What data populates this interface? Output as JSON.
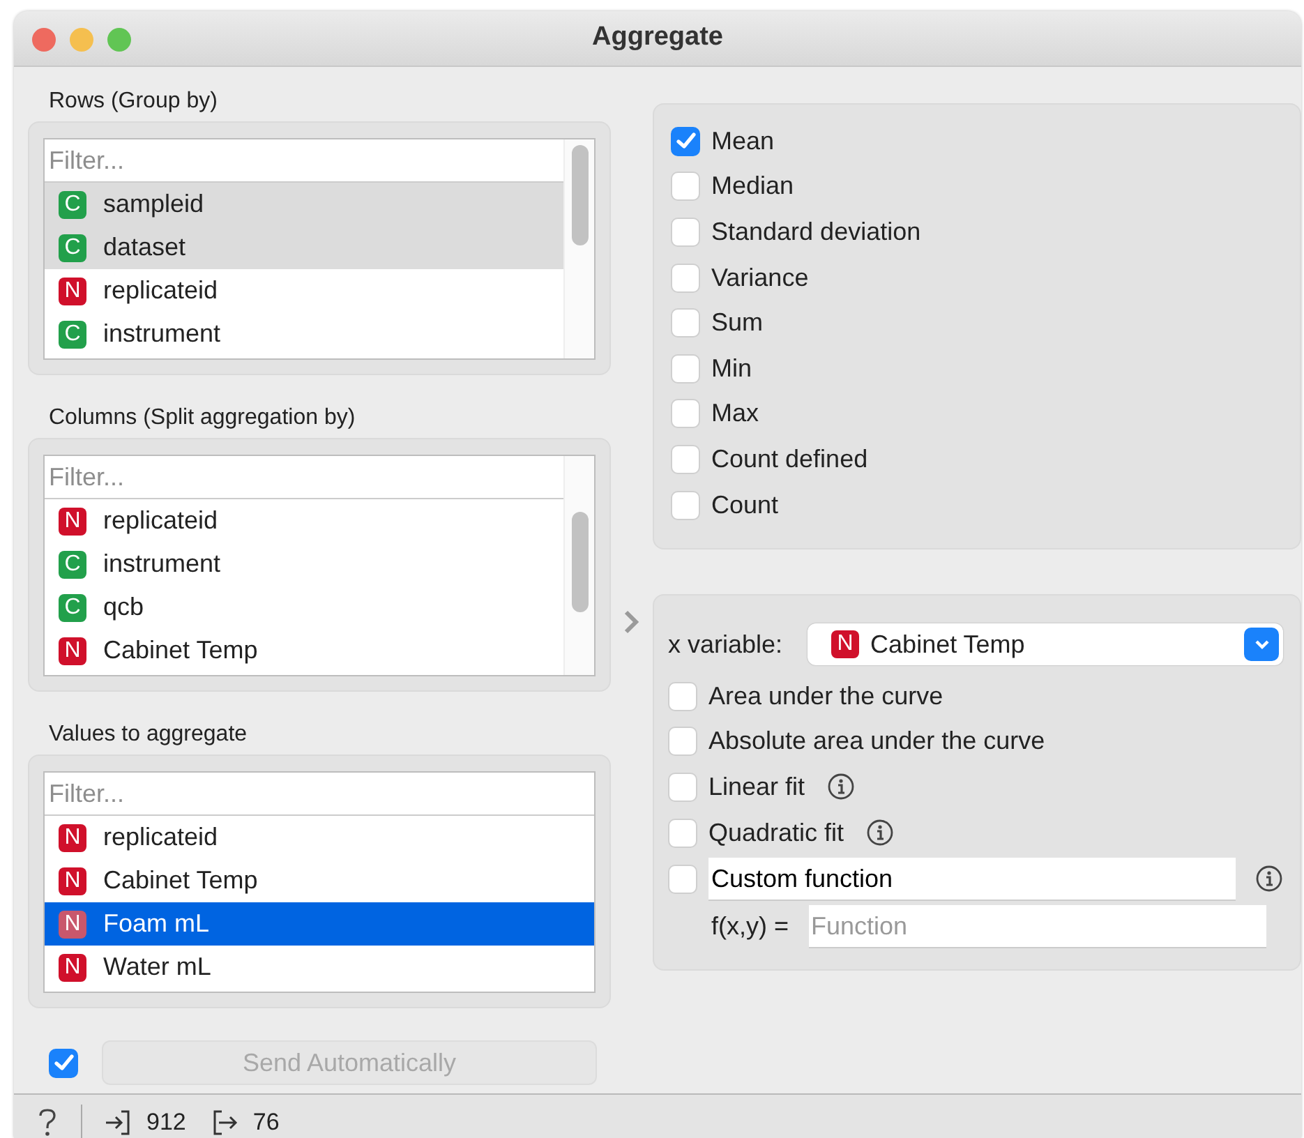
{
  "window": {
    "title": "Aggregate"
  },
  "rows_group_by": {
    "label": "Rows (Group by)",
    "focused": false,
    "filter": {
      "placeholder": "Filter..."
    },
    "scrollbar": true,
    "items": [
      {
        "type": "C",
        "name": "sampleid",
        "selected": true
      },
      {
        "type": "C",
        "name": "dataset",
        "selected": true
      },
      {
        "type": "N",
        "name": "replicateid",
        "selected": false
      },
      {
        "type": "C",
        "name": "instrument",
        "selected": false
      }
    ]
  },
  "columns_split_by": {
    "label": "Columns (Split aggregation by)",
    "filter": {
      "placeholder": "Filter..."
    },
    "scrollbar": true,
    "items": [
      {
        "type": "N",
        "name": "replicateid",
        "selected": false
      },
      {
        "type": "C",
        "name": "instrument",
        "selected": false
      },
      {
        "type": "C",
        "name": "qcb",
        "selected": false
      },
      {
        "type": "N",
        "name": "Cabinet Temp",
        "selected": false
      }
    ]
  },
  "values_to_aggregate": {
    "label": "Values to aggregate",
    "focused": true,
    "filter": {
      "placeholder": "Filter..."
    },
    "scrollbar": false,
    "items": [
      {
        "type": "N",
        "name": "replicateid",
        "selected": false
      },
      {
        "type": "N",
        "name": "Cabinet Temp",
        "selected": false
      },
      {
        "type": "N",
        "name": "Foam mL",
        "selected": true
      },
      {
        "type": "N",
        "name": "Water mL",
        "selected": false
      }
    ]
  },
  "aggregations": [
    {
      "label": "Mean",
      "checked": true
    },
    {
      "label": "Median",
      "checked": false
    },
    {
      "label": "Standard deviation",
      "checked": false
    },
    {
      "label": "Variance",
      "checked": false
    },
    {
      "label": "Sum",
      "checked": false
    },
    {
      "label": "Min",
      "checked": false
    },
    {
      "label": "Max",
      "checked": false
    },
    {
      "label": "Count defined",
      "checked": false
    },
    {
      "label": "Count",
      "checked": false
    }
  ],
  "curve": {
    "x_variable": {
      "label": "x variable:",
      "type": "N",
      "value": "Cabinet Temp"
    },
    "options": [
      {
        "kind": "check",
        "label": "Area under the curve",
        "checked": false
      },
      {
        "kind": "check",
        "label": "Absolute area under the curve",
        "checked": false
      },
      {
        "kind": "info",
        "label": "Linear fit",
        "checked": false
      },
      {
        "kind": "info",
        "label": "Quadratic fit",
        "checked": false
      },
      {
        "kind": "field",
        "value": "Custom function",
        "checked": false
      }
    ],
    "function": {
      "label": "f(x,y) =",
      "placeholder": "Function"
    }
  },
  "auto_send": {
    "checked": true,
    "button": "Send Automatically",
    "disabled": true
  },
  "status_bar": {
    "input_count": "912",
    "output_count": "76"
  }
}
